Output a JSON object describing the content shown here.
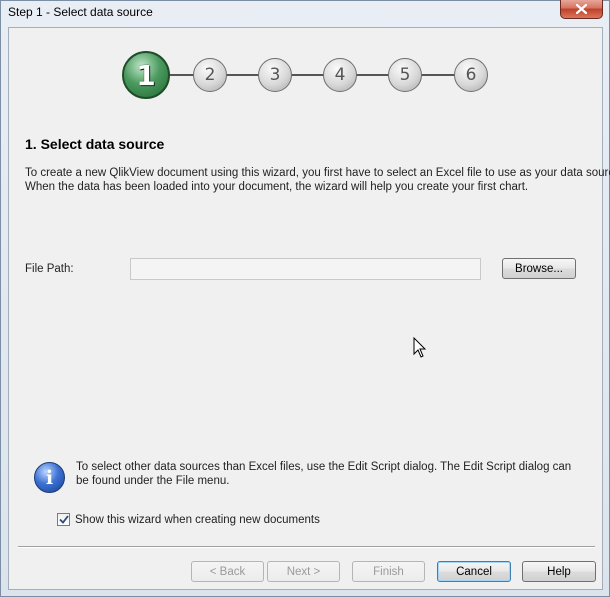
{
  "window": {
    "title": "Step 1 - Select data source"
  },
  "steps": {
    "items": [
      "1",
      "2",
      "3",
      "4",
      "5",
      "6"
    ],
    "active_index": 0
  },
  "section": {
    "title": "1. Select data source",
    "intro_line1": "To create a new QlikView document using this wizard, you first have to select an Excel file to use as your data source.",
    "intro_line2": "When the data has been loaded into your document, the wizard will help you create your first chart."
  },
  "file_path": {
    "label": "File Path:",
    "value": "",
    "browse_label": "Browse..."
  },
  "info": {
    "icon": "info-icon",
    "text": "To select other data sources than Excel files, use the Edit Script dialog. The Edit Script dialog can be found under the File menu."
  },
  "show_wizard": {
    "label": "Show this wizard when creating new documents",
    "checked": true
  },
  "buttons": {
    "back": "< Back",
    "next": "Next >",
    "finish": "Finish",
    "cancel": "Cancel",
    "help": "Help"
  },
  "colors": {
    "active_step": "#2e7d42",
    "inactive_step": "#d0d0d0",
    "close_button": "#c9452e"
  }
}
